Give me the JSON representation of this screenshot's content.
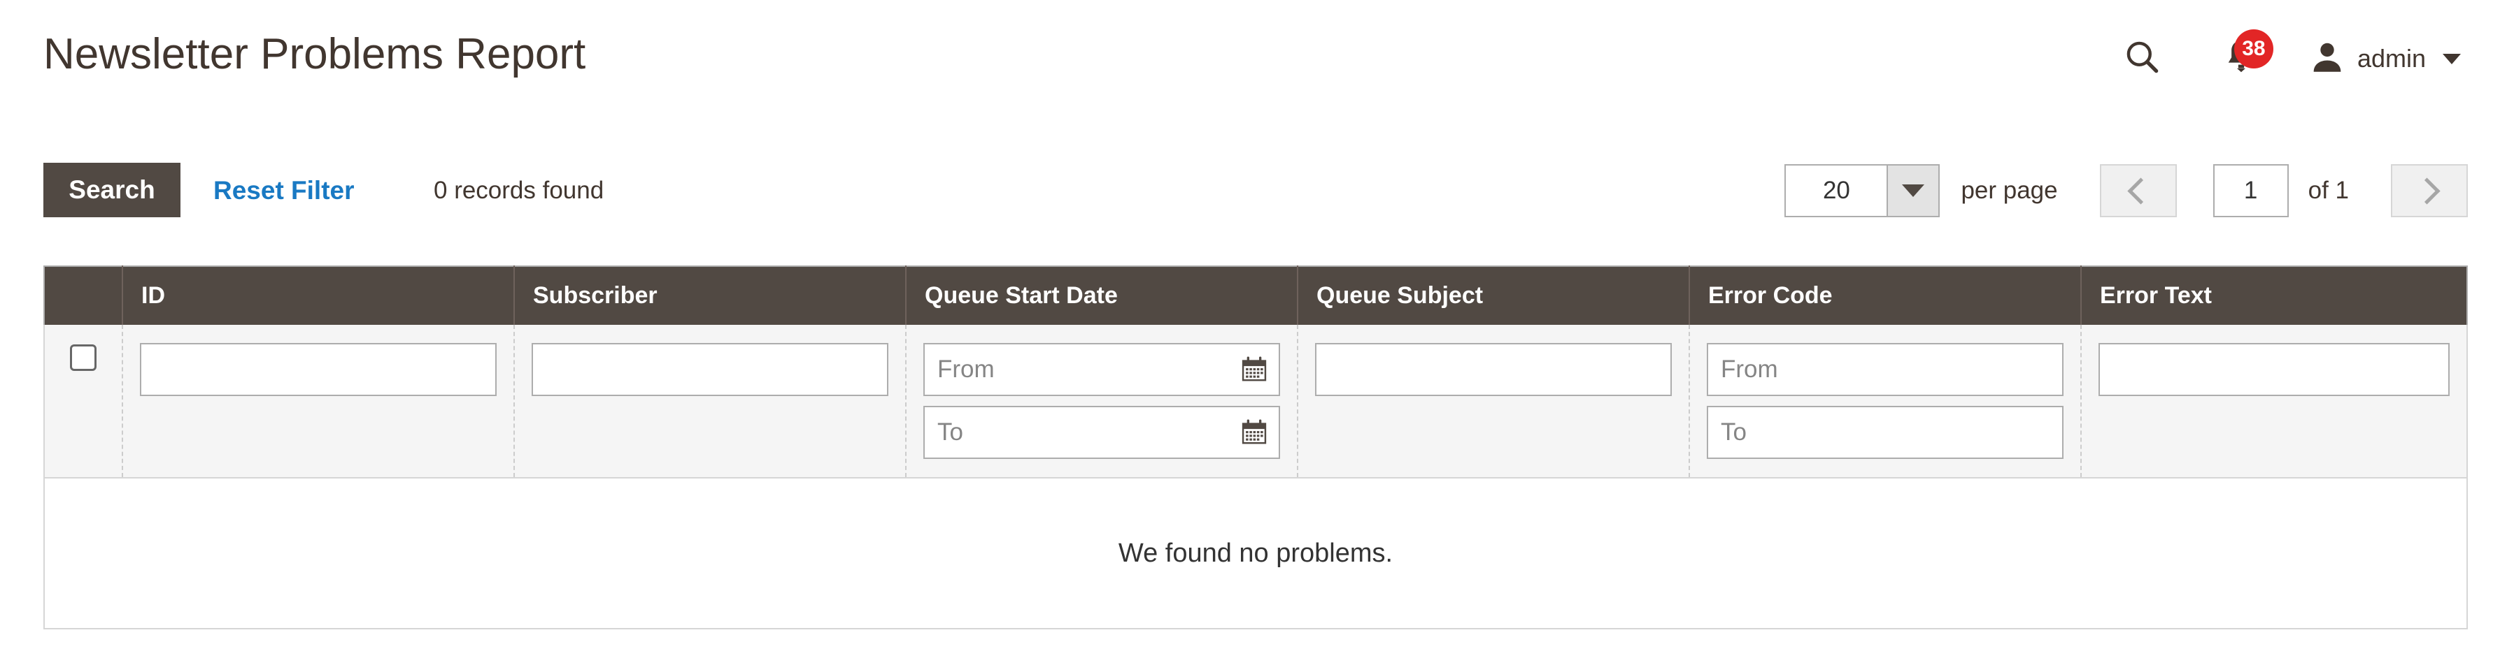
{
  "header": {
    "title": "Newsletter Problems Report",
    "search_icon": "search-icon",
    "notifications": {
      "bell_icon": "bell-icon",
      "count": "38"
    },
    "account": {
      "avatar_icon": "user-avatar-icon",
      "name": "admin",
      "caret_icon": "chevron-down-icon"
    }
  },
  "toolbar": {
    "search_label": "Search",
    "reset_filter_label": "Reset Filter",
    "records_found": "0 records found",
    "pager": {
      "limit_value": "20",
      "limit_caret_icon": "triangle-down-icon",
      "per_page_label": "per page",
      "prev_icon": "chevron-left-icon",
      "current_page": "1",
      "of_label": "of 1",
      "next_icon": "chevron-right-icon"
    }
  },
  "grid": {
    "columns": [
      {
        "key": "id",
        "label": "ID"
      },
      {
        "key": "subscriber",
        "label": "Subscriber"
      },
      {
        "key": "queue_start_date",
        "label": "Queue Start Date"
      },
      {
        "key": "queue_subject",
        "label": "Queue Subject"
      },
      {
        "key": "error_code",
        "label": "Error Code"
      },
      {
        "key": "error_text",
        "label": "Error Text"
      }
    ],
    "filters": {
      "select_all_checkbox": "",
      "id": {
        "value": "",
        "placeholder": ""
      },
      "subscriber": {
        "value": "",
        "placeholder": ""
      },
      "queue_start_date_from": {
        "value": "",
        "placeholder": "From",
        "icon": "calendar-icon"
      },
      "queue_start_date_to": {
        "value": "",
        "placeholder": "To",
        "icon": "calendar-icon"
      },
      "queue_subject": {
        "value": "",
        "placeholder": ""
      },
      "error_code_from": {
        "value": "",
        "placeholder": "From"
      },
      "error_code_to": {
        "value": "",
        "placeholder": "To"
      },
      "error_text": {
        "value": "",
        "placeholder": ""
      }
    },
    "empty_message": "We found no problems.",
    "rows": []
  },
  "colors": {
    "header_bar": "#514943",
    "link": "#1979c3",
    "badge": "#e22626",
    "filter_row_bg": "#f5f5f5",
    "text": "#41362f"
  }
}
